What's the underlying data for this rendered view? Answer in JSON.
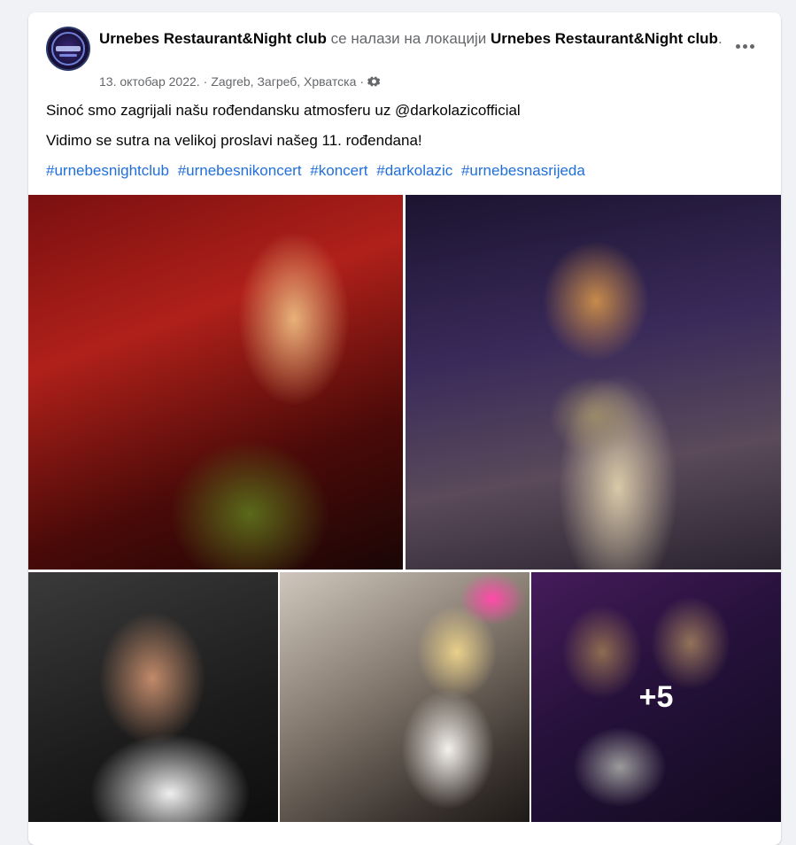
{
  "post": {
    "page_name": "Urnebes Restaurant&Night club",
    "location_phrase": " се налази на локацији ",
    "location_name": "Urnebes Restaurant&Night club",
    "title_suffix": ".",
    "date": "13. октобар 2022.",
    "separator": " · ",
    "place": "Zagreb, Загреб, Хрватска",
    "audience_icon": "gear-icon",
    "line1": "Sinoć smo zagrijali našu rođendansku atmosferu uz @darkolazicofficial",
    "line2": "Vidimo se sutra na velikoj proslavi našeg 11. rođendana!",
    "hashtags": [
      "#urnebesnightclub",
      "#urnebesnikoncert",
      "#koncert",
      "#darkolazic",
      "#urnebesnasrijeda"
    ],
    "more_photos": "+5"
  },
  "colors": {
    "link": "#216fdb",
    "text": "#050505",
    "secondary": "#65676b",
    "background": "#f0f2f5"
  }
}
